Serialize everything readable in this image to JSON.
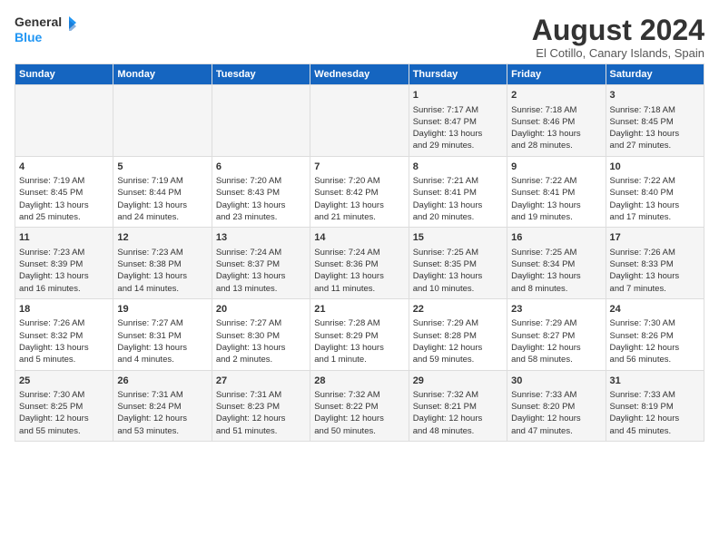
{
  "header": {
    "title": "August 2024",
    "subtitle": "El Cotillo, Canary Islands, Spain",
    "logo_line1": "General",
    "logo_line2": "Blue"
  },
  "days_of_week": [
    "Sunday",
    "Monday",
    "Tuesday",
    "Wednesday",
    "Thursday",
    "Friday",
    "Saturday"
  ],
  "weeks": [
    [
      {
        "day": "",
        "info": ""
      },
      {
        "day": "",
        "info": ""
      },
      {
        "day": "",
        "info": ""
      },
      {
        "day": "",
        "info": ""
      },
      {
        "day": "1",
        "info": "Sunrise: 7:17 AM\nSunset: 8:47 PM\nDaylight: 13 hours\nand 29 minutes."
      },
      {
        "day": "2",
        "info": "Sunrise: 7:18 AM\nSunset: 8:46 PM\nDaylight: 13 hours\nand 28 minutes."
      },
      {
        "day": "3",
        "info": "Sunrise: 7:18 AM\nSunset: 8:45 PM\nDaylight: 13 hours\nand 27 minutes."
      }
    ],
    [
      {
        "day": "4",
        "info": "Sunrise: 7:19 AM\nSunset: 8:45 PM\nDaylight: 13 hours\nand 25 minutes."
      },
      {
        "day": "5",
        "info": "Sunrise: 7:19 AM\nSunset: 8:44 PM\nDaylight: 13 hours\nand 24 minutes."
      },
      {
        "day": "6",
        "info": "Sunrise: 7:20 AM\nSunset: 8:43 PM\nDaylight: 13 hours\nand 23 minutes."
      },
      {
        "day": "7",
        "info": "Sunrise: 7:20 AM\nSunset: 8:42 PM\nDaylight: 13 hours\nand 21 minutes."
      },
      {
        "day": "8",
        "info": "Sunrise: 7:21 AM\nSunset: 8:41 PM\nDaylight: 13 hours\nand 20 minutes."
      },
      {
        "day": "9",
        "info": "Sunrise: 7:22 AM\nSunset: 8:41 PM\nDaylight: 13 hours\nand 19 minutes."
      },
      {
        "day": "10",
        "info": "Sunrise: 7:22 AM\nSunset: 8:40 PM\nDaylight: 13 hours\nand 17 minutes."
      }
    ],
    [
      {
        "day": "11",
        "info": "Sunrise: 7:23 AM\nSunset: 8:39 PM\nDaylight: 13 hours\nand 16 minutes."
      },
      {
        "day": "12",
        "info": "Sunrise: 7:23 AM\nSunset: 8:38 PM\nDaylight: 13 hours\nand 14 minutes."
      },
      {
        "day": "13",
        "info": "Sunrise: 7:24 AM\nSunset: 8:37 PM\nDaylight: 13 hours\nand 13 minutes."
      },
      {
        "day": "14",
        "info": "Sunrise: 7:24 AM\nSunset: 8:36 PM\nDaylight: 13 hours\nand 11 minutes."
      },
      {
        "day": "15",
        "info": "Sunrise: 7:25 AM\nSunset: 8:35 PM\nDaylight: 13 hours\nand 10 minutes."
      },
      {
        "day": "16",
        "info": "Sunrise: 7:25 AM\nSunset: 8:34 PM\nDaylight: 13 hours\nand 8 minutes."
      },
      {
        "day": "17",
        "info": "Sunrise: 7:26 AM\nSunset: 8:33 PM\nDaylight: 13 hours\nand 7 minutes."
      }
    ],
    [
      {
        "day": "18",
        "info": "Sunrise: 7:26 AM\nSunset: 8:32 PM\nDaylight: 13 hours\nand 5 minutes."
      },
      {
        "day": "19",
        "info": "Sunrise: 7:27 AM\nSunset: 8:31 PM\nDaylight: 13 hours\nand 4 minutes."
      },
      {
        "day": "20",
        "info": "Sunrise: 7:27 AM\nSunset: 8:30 PM\nDaylight: 13 hours\nand 2 minutes."
      },
      {
        "day": "21",
        "info": "Sunrise: 7:28 AM\nSunset: 8:29 PM\nDaylight: 13 hours\nand 1 minute."
      },
      {
        "day": "22",
        "info": "Sunrise: 7:29 AM\nSunset: 8:28 PM\nDaylight: 12 hours\nand 59 minutes."
      },
      {
        "day": "23",
        "info": "Sunrise: 7:29 AM\nSunset: 8:27 PM\nDaylight: 12 hours\nand 58 minutes."
      },
      {
        "day": "24",
        "info": "Sunrise: 7:30 AM\nSunset: 8:26 PM\nDaylight: 12 hours\nand 56 minutes."
      }
    ],
    [
      {
        "day": "25",
        "info": "Sunrise: 7:30 AM\nSunset: 8:25 PM\nDaylight: 12 hours\nand 55 minutes."
      },
      {
        "day": "26",
        "info": "Sunrise: 7:31 AM\nSunset: 8:24 PM\nDaylight: 12 hours\nand 53 minutes."
      },
      {
        "day": "27",
        "info": "Sunrise: 7:31 AM\nSunset: 8:23 PM\nDaylight: 12 hours\nand 51 minutes."
      },
      {
        "day": "28",
        "info": "Sunrise: 7:32 AM\nSunset: 8:22 PM\nDaylight: 12 hours\nand 50 minutes."
      },
      {
        "day": "29",
        "info": "Sunrise: 7:32 AM\nSunset: 8:21 PM\nDaylight: 12 hours\nand 48 minutes."
      },
      {
        "day": "30",
        "info": "Sunrise: 7:33 AM\nSunset: 8:20 PM\nDaylight: 12 hours\nand 47 minutes."
      },
      {
        "day": "31",
        "info": "Sunrise: 7:33 AM\nSunset: 8:19 PM\nDaylight: 12 hours\nand 45 minutes."
      }
    ]
  ]
}
